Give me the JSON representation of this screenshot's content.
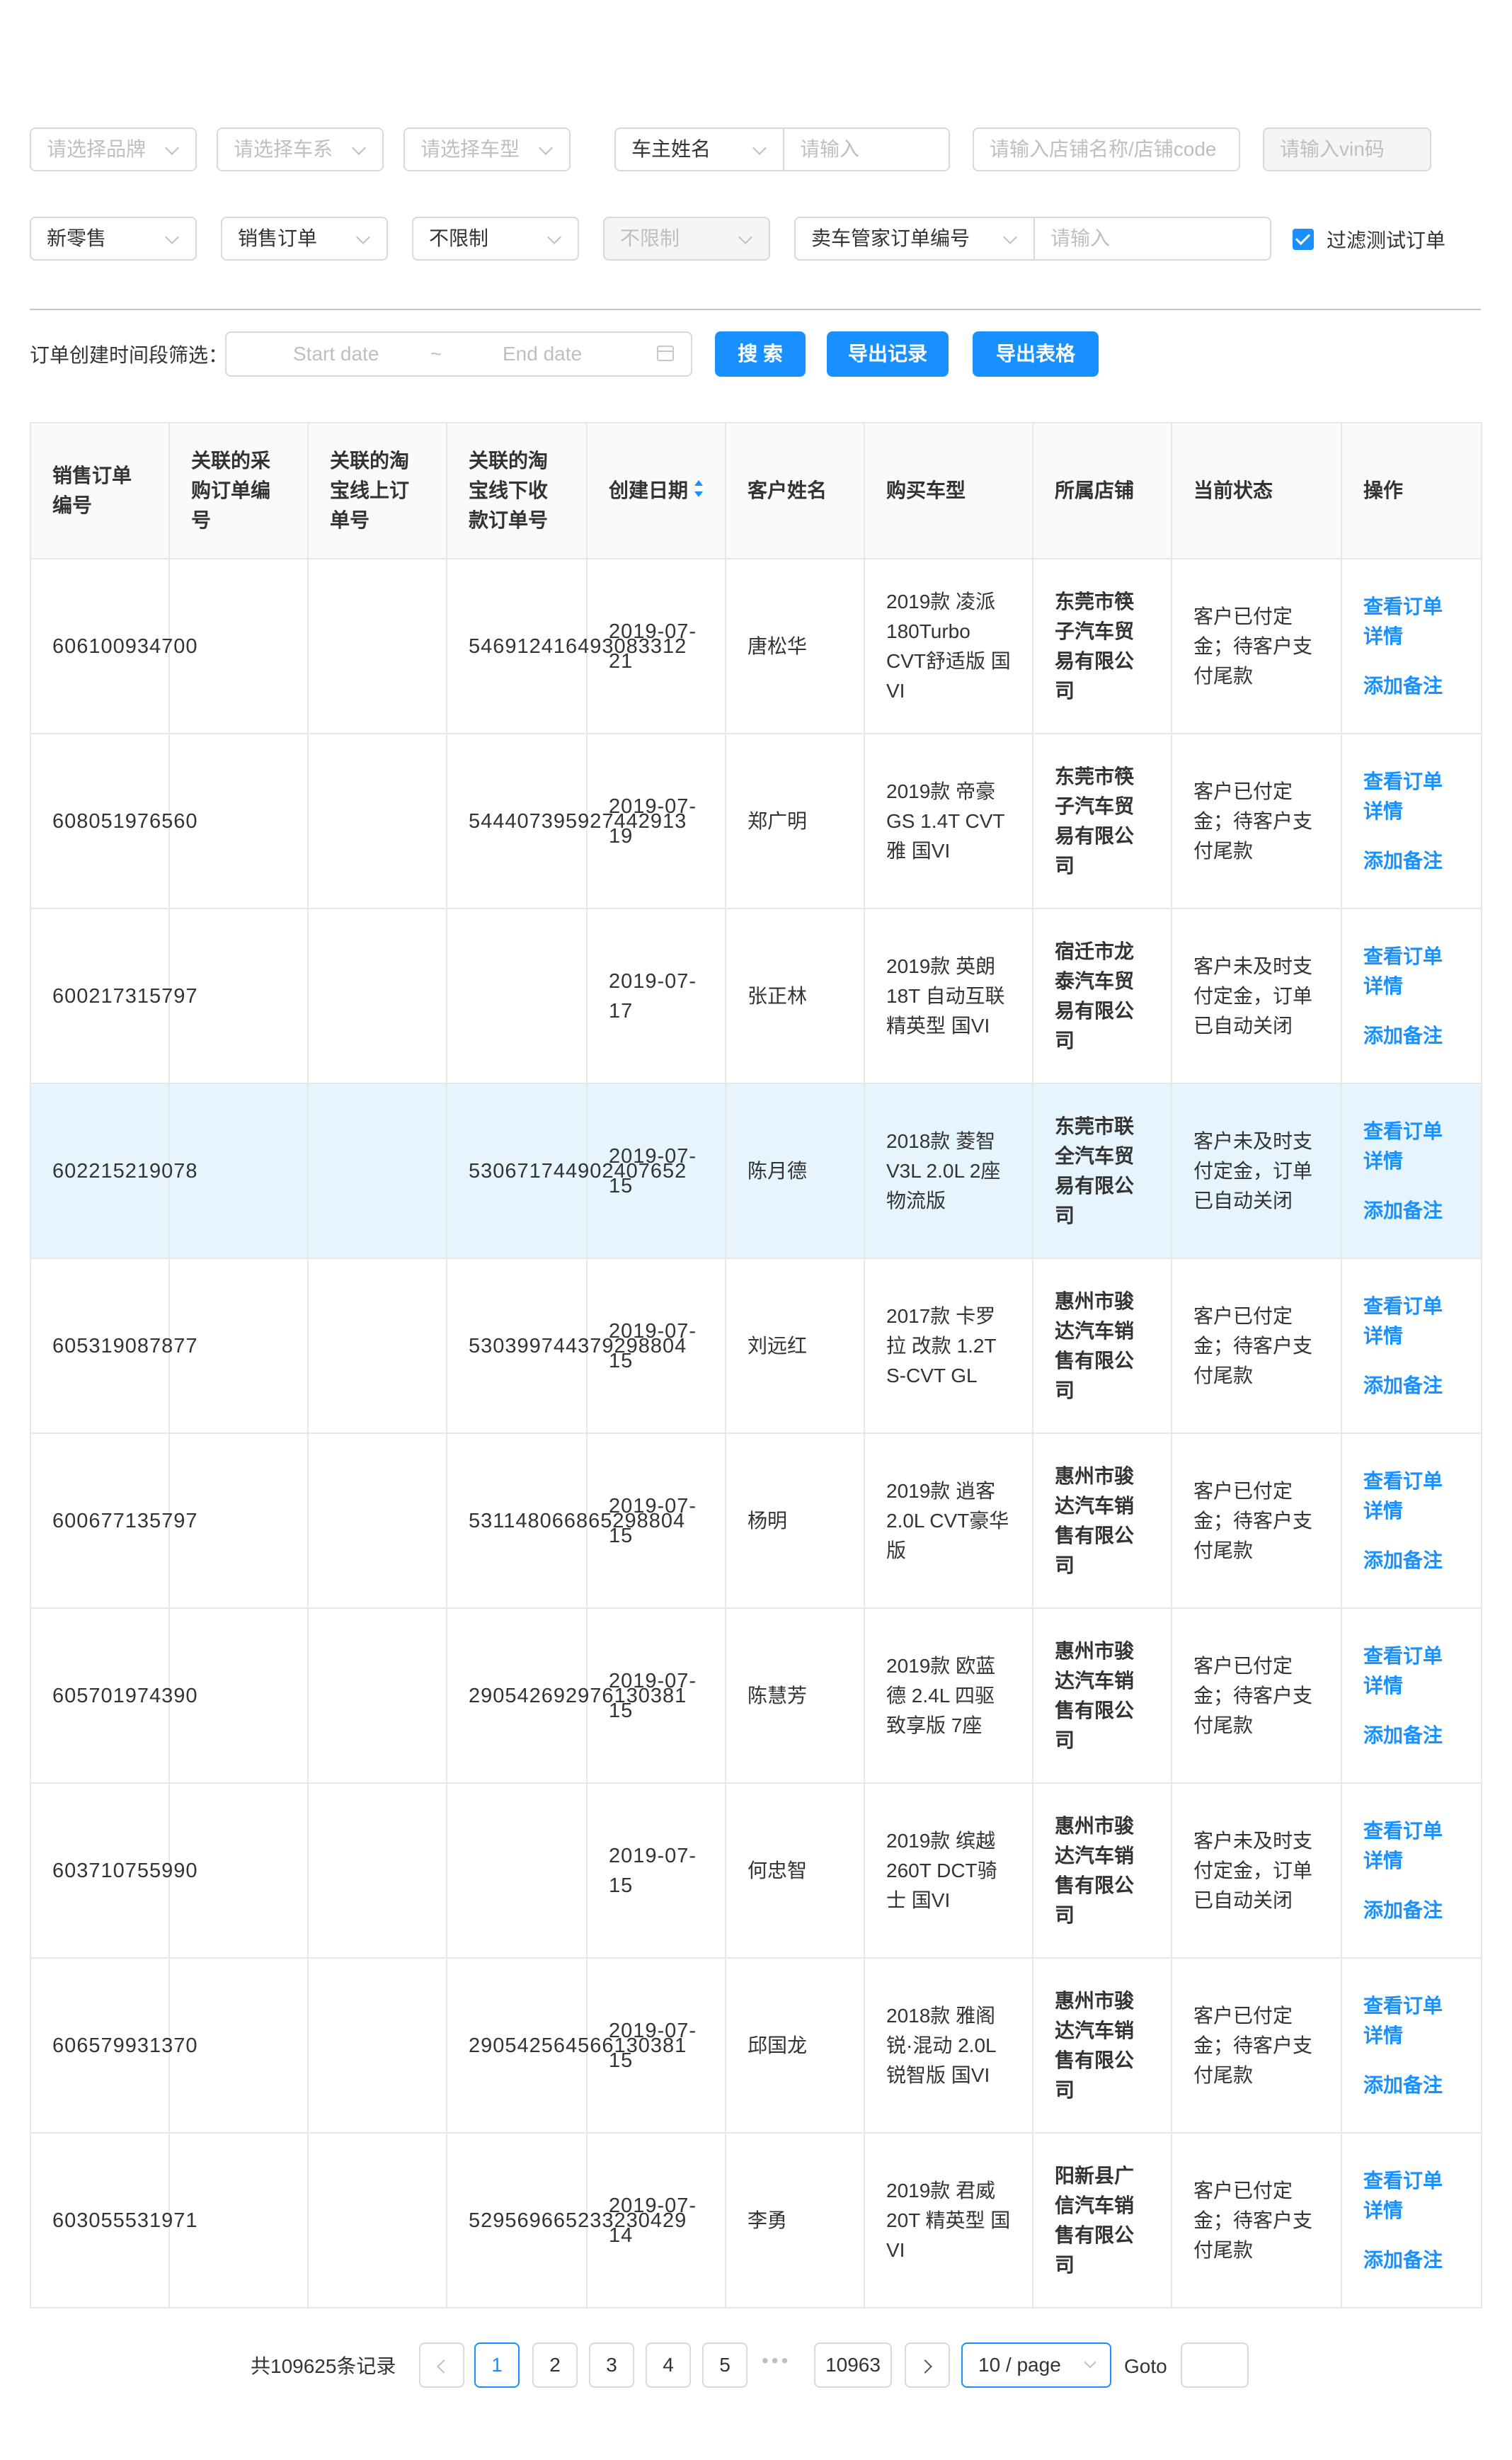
{
  "filters_row1": {
    "brand_select": "请选择品牌",
    "series_select": "请选择车系",
    "model_select": "请选择车型",
    "owner_field_select": "车主姓名",
    "owner_input_placeholder": "请输入",
    "store_input_placeholder": "请输入店铺名称/店铺code",
    "vin_input_placeholder": "请输入vin码"
  },
  "filters_row2": {
    "channel_select": "新零售",
    "order_type_select": "销售订单",
    "limit_select": "不限制",
    "limit_select_disabled": "不限制",
    "order_no_select": "卖车管家订单编号",
    "order_no_input_placeholder": "请输入",
    "filter_test_label": "过滤测试订单",
    "filter_test_checked": true
  },
  "date_filter": {
    "label": "订单创建时间段筛选：",
    "start_placeholder": "Start date",
    "separator": "~",
    "end_placeholder": "End date"
  },
  "actions": {
    "search": "搜 索",
    "export_records": "导出记录",
    "export_table": "导出表格"
  },
  "table": {
    "headers": [
      "销售订单编号",
      "关联的采购订单编号",
      "关联的淘宝线上订单号",
      "关联的淘宝线下收款订单号",
      "创建日期",
      "客户姓名",
      "购买车型",
      "所属店铺",
      "当前状态",
      "操作"
    ],
    "view_link": "查看订单详情",
    "note_link": "添加备注",
    "rows": [
      {
        "order_no": "606100934700",
        "purchase_no": "",
        "taobao_online": "",
        "taobao_offline": "546912416493083312",
        "date": "2019-07-21",
        "customer": "唐松华",
        "model": "2019款 凌派 180Turbo CVT舒适版 国VI",
        "store": "东莞市筷子汽车贸易有限公司",
        "status": "客户已付定金；待客户支付尾款"
      },
      {
        "order_no": "608051976560",
        "purchase_no": "",
        "taobao_online": "",
        "taobao_offline": "544407395927442913",
        "date": "2019-07-19",
        "customer": "郑广明",
        "model": "2019款 帝豪GS 1.4T CVT雅 国VI",
        "store": "东莞市筷子汽车贸易有限公司",
        "status": "客户已付定金；待客户支付尾款"
      },
      {
        "order_no": "600217315797",
        "purchase_no": "",
        "taobao_online": "",
        "taobao_offline": "",
        "date": "2019-07-17",
        "customer": "张正林",
        "model": "2019款 英朗 18T 自动互联精英型 国VI",
        "store": "宿迁市龙泰汽车贸易有限公司",
        "status": "客户未及时支付定金，订单已自动关闭"
      },
      {
        "order_no": "602215219078",
        "purchase_no": "",
        "taobao_online": "",
        "taobao_offline": "530671744902407652",
        "date": "2019-07-15",
        "customer": "陈月德",
        "model": "2018款 菱智 V3L 2.0L 2座 物流版",
        "store": "东莞市联全汽车贸易有限公司",
        "status": "客户未及时支付定金，订单已自动关闭"
      },
      {
        "order_no": "605319087877",
        "purchase_no": "",
        "taobao_online": "",
        "taobao_offline": "530399744379298804",
        "date": "2019-07-15",
        "customer": "刘远红",
        "model": "2017款 卡罗拉 改款 1.2T S-CVT GL",
        "store": "惠州市骏达汽车销售有限公司",
        "status": "客户已付定金；待客户支付尾款"
      },
      {
        "order_no": "600677135797",
        "purchase_no": "",
        "taobao_online": "",
        "taobao_offline": "531148066865298804",
        "date": "2019-07-15",
        "customer": "杨明",
        "model": "2019款 逍客 2.0L CVT豪华版",
        "store": "惠州市骏达汽车销售有限公司",
        "status": "客户已付定金；待客户支付尾款"
      },
      {
        "order_no": "605701974390",
        "purchase_no": "",
        "taobao_online": "",
        "taobao_offline": "290542692976130381",
        "date": "2019-07-15",
        "customer": "陈慧芳",
        "model": "2019款 欧蓝德 2.4L 四驱致享版 7座",
        "store": "惠州市骏达汽车销售有限公司",
        "status": "客户已付定金；待客户支付尾款"
      },
      {
        "order_no": "603710755990",
        "purchase_no": "",
        "taobao_online": "",
        "taobao_offline": "",
        "date": "2019-07-15",
        "customer": "何忠智",
        "model": "2019款 缤越 260T DCT骑士 国VI",
        "store": "惠州市骏达汽车销售有限公司",
        "status": "客户未及时支付定金，订单已自动关闭"
      },
      {
        "order_no": "606579931370",
        "purchase_no": "",
        "taobao_online": "",
        "taobao_offline": "290542564566130381",
        "date": "2019-07-15",
        "customer": "邱国龙",
        "model": "2018款 雅阁 锐·混动 2.0L 锐智版 国VI",
        "store": "惠州市骏达汽车销售有限公司",
        "status": "客户已付定金；待客户支付尾款"
      },
      {
        "order_no": "603055531971",
        "purchase_no": "",
        "taobao_online": "",
        "taobao_offline": "529569665233230429",
        "date": "2019-07-14",
        "customer": "李勇",
        "model": "2019款 君威 20T 精英型 国VI",
        "store": "阳新县广信汽车销售有限公司",
        "status": "客户已付定金；待客户支付尾款"
      }
    ]
  },
  "pagination": {
    "total": "共109625条记录",
    "pages": [
      "1",
      "2",
      "3",
      "4",
      "5"
    ],
    "ellipsis": "•••",
    "last_page": "10963",
    "current_page": 1,
    "page_size": "10 / page",
    "goto_label": "Goto"
  },
  "colors": {
    "primary": "#1890ff",
    "highlight_row": "#e6f4fd",
    "border": "#e8e8e8"
  }
}
